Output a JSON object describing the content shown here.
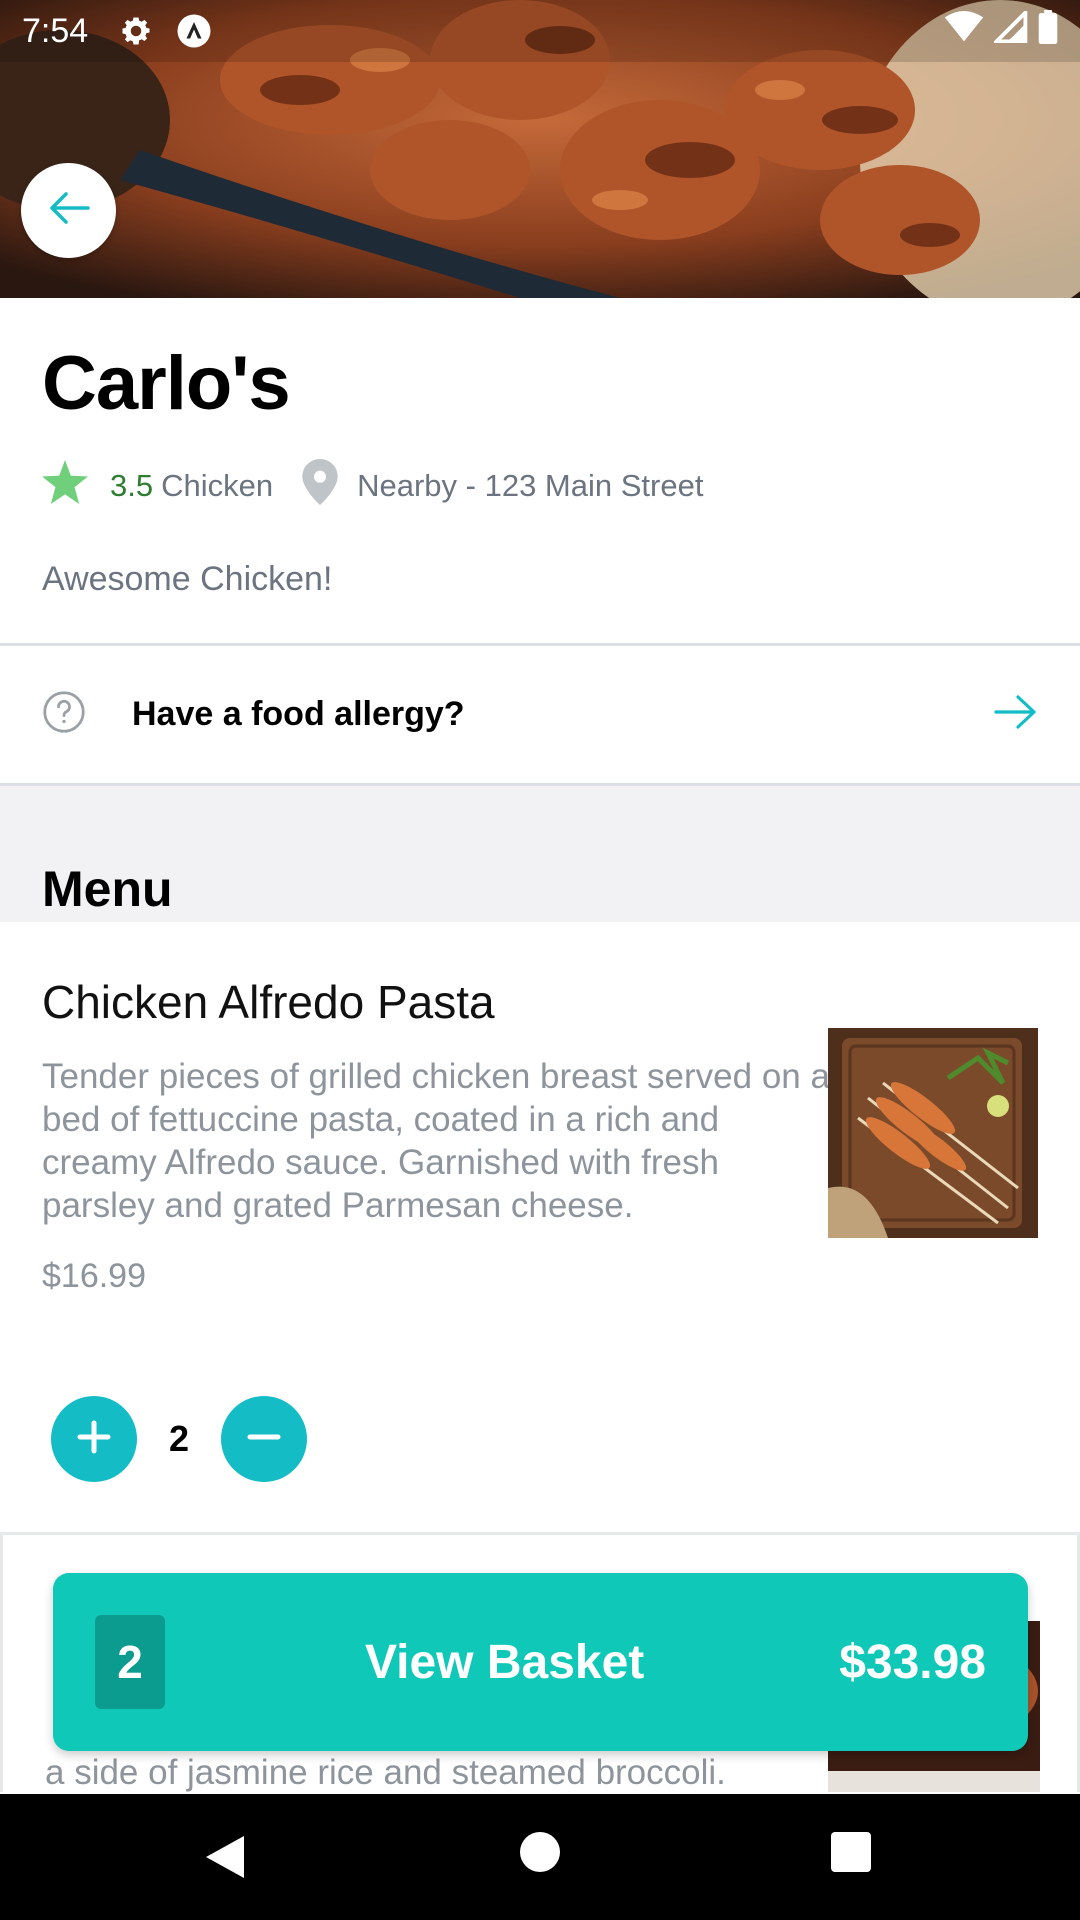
{
  "status_bar": {
    "time": "7:54"
  },
  "restaurant": {
    "name": "Carlo's",
    "rating": "3.5",
    "cuisine": "Chicken",
    "location": "Nearby - 123 Main Street",
    "tagline": "Awesome Chicken!"
  },
  "allergy": {
    "label": "Have a food allergy?"
  },
  "menu": {
    "header": "Menu",
    "items": [
      {
        "name": "Chicken Alfredo Pasta",
        "description": "Tender pieces of grilled chicken breast served on a bed of fettuccine pasta, coated in a rich and creamy Alfredo sauce. Garnished with fresh parsley and grated Parmesan cheese.",
        "price": "$16.99",
        "quantity": "2"
      },
      {
        "name": "",
        "description_visible": "a side of jasmine rice and steamed broccoli."
      }
    ]
  },
  "basket": {
    "count": "2",
    "label": "View Basket",
    "total": "$33.98"
  },
  "colors": {
    "accent": "#14bcc6",
    "basket": "#10c8b8",
    "rating": "#2e7d32",
    "star": "#6fcf7a"
  },
  "icons": {
    "back": "arrow-left-icon",
    "star": "star-icon",
    "location": "location-pin-icon",
    "help": "question-circle-icon",
    "forward": "arrow-right-icon",
    "plus": "plus-icon",
    "minus": "minus-icon"
  }
}
